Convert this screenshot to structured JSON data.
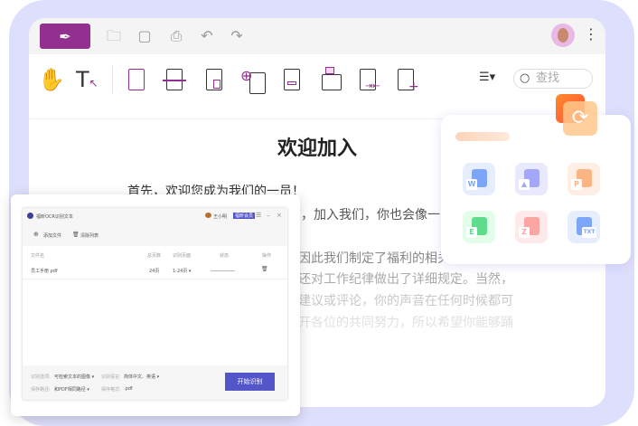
{
  "toolbar": {
    "search_placeholder": "查找"
  },
  "document": {
    "title": "欢迎加入",
    "lines": [
      "首先，欢迎您成为我们的一员！",
      "，加入我们，你也会像一",
      "因此我们制定了福利的相关",
      "还对工作纪律做出了详细规定。当然，",
      "建议或评论，你的声音在任何时候都可",
      "开各位的共同努力，所以希望你能够踊"
    ]
  },
  "convert_panel": {
    "formats": [
      {
        "icon": "word-icon",
        "letter": "W",
        "color": "#7ea6f8"
      },
      {
        "icon": "image-icon",
        "letter": "▲",
        "color": "#a4a6f8"
      },
      {
        "icon": "ppt-icon",
        "letter": "P",
        "color": "#fbb585"
      },
      {
        "icon": "excel-icon",
        "letter": "E",
        "color": "#5fdc8c"
      },
      {
        "icon": "pdf-icon",
        "letter": "Z",
        "color": "#fba5a5"
      },
      {
        "icon": "txt-icon",
        "letter": "TXT",
        "color": "#7ea6f8"
      }
    ]
  },
  "ocr": {
    "title": "福昕OCR识别文本",
    "user": "王小明",
    "badge": "福昕会员",
    "add_file": "添加文件",
    "clear_list": "清除列表",
    "columns": [
      "文件名",
      "总页数",
      "识别页面",
      "状态",
      "操作"
    ],
    "rows": [
      {
        "name": "员工手册.pdf",
        "pages": "24页",
        "range": "1-24页 ▾"
      }
    ],
    "option_label": "识别选项:",
    "option_value": "可检索文本的图像 ▾",
    "lang_label": "识别语言:",
    "lang_value": "简体中文、英语 ▾",
    "path_label": "保存路径:",
    "path_value": "和PDF相同路径 ▾",
    "format_label": "保存格式:",
    "format_value": ".pdf",
    "start": "开始识别"
  },
  "colors": {
    "brand": "#93308f",
    "frame": "#dedffc",
    "ocr_button": "#5356c9"
  }
}
